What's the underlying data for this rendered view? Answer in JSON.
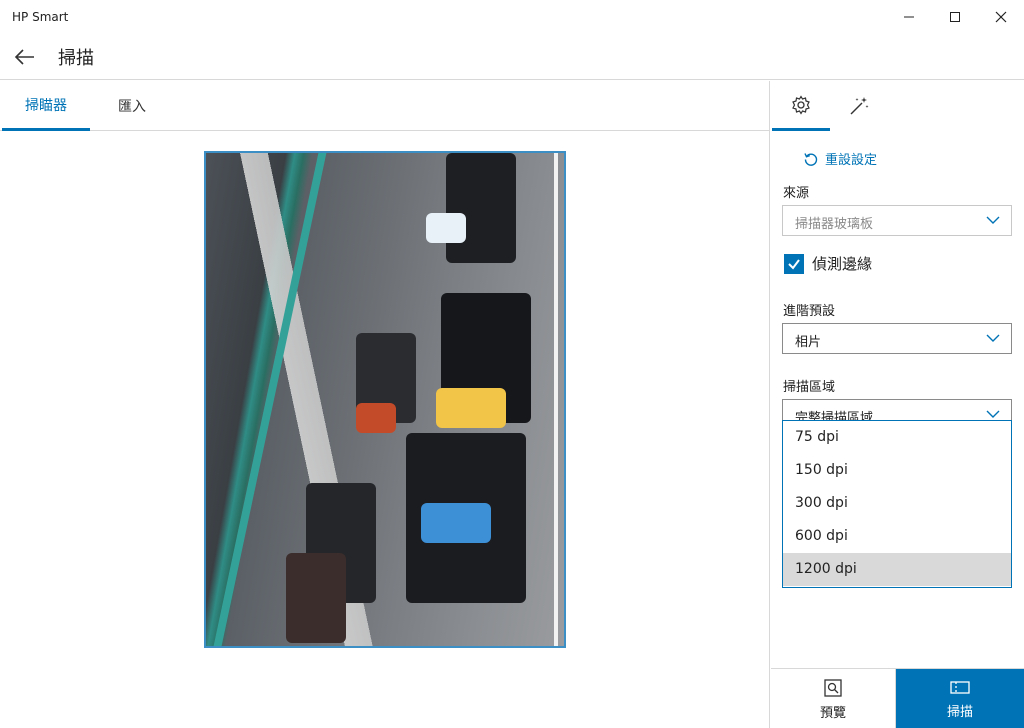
{
  "window": {
    "app_title": "HP Smart",
    "minimize_glyph": "—",
    "maximize_glyph": "☐",
    "close_glyph": "✕"
  },
  "header": {
    "back_icon": "back-arrow-icon",
    "title": "掃描"
  },
  "tabs": [
    {
      "label": "掃瞄器",
      "active": true
    },
    {
      "label": "匯入",
      "active": false
    }
  ],
  "settings_panel": {
    "tabs": [
      {
        "icon": "gear-icon",
        "active": true
      },
      {
        "icon": "magic-wand-icon",
        "active": false
      }
    ],
    "reset_label": "重設設定",
    "source": {
      "label": "來源",
      "value": "掃描器玻璃板"
    },
    "detect_edges": {
      "label": "偵測邊緣",
      "checked": true
    },
    "preset": {
      "label": "進階預設",
      "value": "相片"
    },
    "scan_area": {
      "label": "掃描區域",
      "value": "完整掃描區域"
    },
    "resolution_dropdown": {
      "options": [
        "75 dpi",
        "150 dpi",
        "300 dpi",
        "600 dpi",
        "1200 dpi"
      ],
      "highlighted": "1200 dpi"
    }
  },
  "bottom_bar": {
    "preview_label": "預覽",
    "scan_label": "掃描"
  },
  "colors": {
    "accent": "#0073b6",
    "preview_border": "#3b8fc4",
    "highlight": "#d9d9d9"
  }
}
